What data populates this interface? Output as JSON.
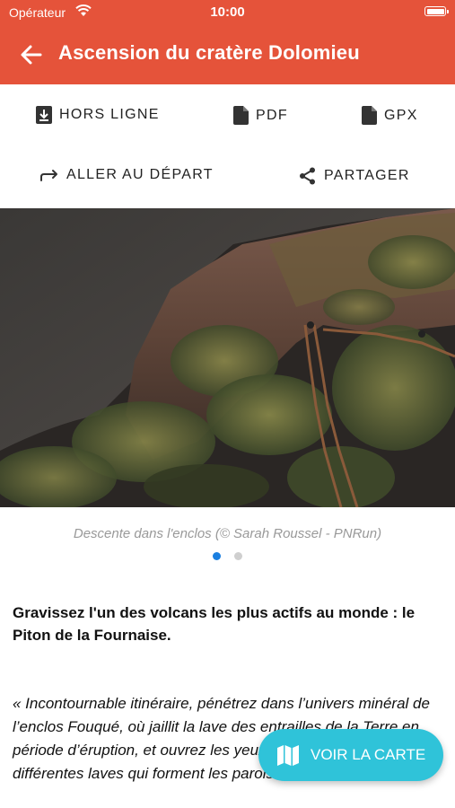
{
  "status_bar": {
    "carrier": "Opérateur",
    "time": "10:00"
  },
  "header": {
    "title": "Ascension du cratère Dolomieu",
    "back_icon": "arrow-left-icon"
  },
  "actions": {
    "offline": "HORS LIGNE",
    "pdf": "PDF",
    "gpx": "GPX",
    "go_to_start": "ALLER AU DÉPART",
    "share": "PARTAGER"
  },
  "gallery": {
    "caption": "Descente dans l'enclos (© Sarah Roussel - PNRun)",
    "pages": 2,
    "current_page": 1
  },
  "description": {
    "lead": "Gravissez l'un des volcans les plus actifs au monde : le Piton de la Fournaise.",
    "quote": "« Incontournable itinéraire, pénétrez dans l’univers minéral de l’enclos Fouqué, où jaillit la lave des entrailles de la Terre en période d’éruption, et ouvrez les yeux sur l’empilement de différentes laves qui forment les parois du le cratère actuel."
  },
  "map_button": {
    "label": "VOIR LA CARTE",
    "icon": "map-icon"
  },
  "colors": {
    "primary": "#e5533a",
    "accent": "#2fc3d9",
    "dot_active": "#1a7fe0"
  }
}
